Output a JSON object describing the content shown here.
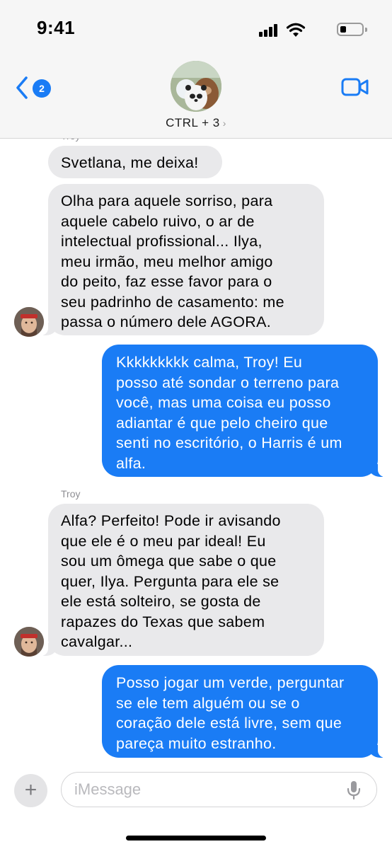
{
  "status_bar": {
    "time": "9:41",
    "battery_level": 0.3
  },
  "header": {
    "back_badge": "2",
    "group_name": "CTRL + 3",
    "chevron": "›",
    "icons": {
      "back": "chevron-left-icon",
      "video": "video-camera-icon"
    },
    "accent_color": "#1a7cf5"
  },
  "messages": {
    "top_sender_partial": "Troy",
    "m1": "Svetlana, me deixa!",
    "m2": "Olha para aquele sorriso, para\naquele cabelo ruivo, o ar de\nintelectual profissional... Ilya,\nmeu irmão, meu melhor amigo\ndo peito, faz esse favor para o\nseu padrinho de casamento: me\npassa o número dele AGORA.",
    "m3": "Kkkkkkkkk calma, Troy! Eu\nposso até sondar o terreno para\nvocê, mas uma coisa eu posso\nadiantar é que pelo cheiro que\nsenti no escritório, o Harris é um\nalfa.",
    "sender2": "Troy",
    "m4": "Alfa? Perfeito! Pode ir avisando\nque ele é o meu par ideal! Eu\nsou um ômega que sabe o que\nquer, Ilya. Pergunta para ele se\nele está solteiro, se gosta de\nrapazes do Texas que sabem\ncavalgar...",
    "m5": "Posso jogar um verde, perguntar\nse ele tem alguém ou se o\ncoração dele está livre, sem que\npareça muito estranho."
  },
  "composer": {
    "plus": "+",
    "placeholder": "iMessage",
    "value": "",
    "mic_icon": "microphone-icon"
  }
}
